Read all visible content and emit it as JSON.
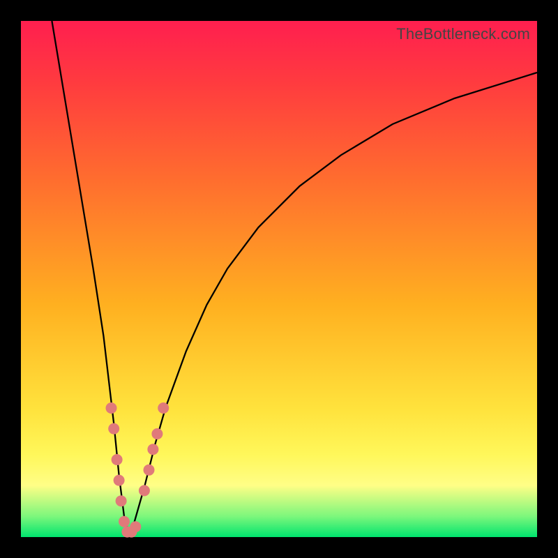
{
  "watermark": "TheBottleneck.com",
  "colors": {
    "frame": "#000000",
    "gradient_top": "#ff1f4f",
    "gradient_mid": "#ffe23c",
    "gradient_bottom": "#00e46e",
    "curve": "#000000",
    "dots": "#e07a7a"
  },
  "chart_data": {
    "type": "line",
    "title": "",
    "xlabel": "",
    "ylabel": "",
    "xlim": [
      0,
      100
    ],
    "ylim": [
      0,
      100
    ],
    "note": "V-shaped bottleneck curve; y is approximate bottleneck percentage, minimum near x≈21",
    "series": [
      {
        "name": "bottleneck-curve",
        "x": [
          6,
          8,
          10,
          12,
          14,
          16,
          18,
          19,
          20,
          21,
          22,
          24,
          26,
          28,
          32,
          36,
          40,
          46,
          54,
          62,
          72,
          84,
          100
        ],
        "values": [
          100,
          88,
          76,
          64,
          52,
          39,
          22,
          12,
          4,
          0,
          3,
          10,
          18,
          25,
          36,
          45,
          52,
          60,
          68,
          74,
          80,
          85,
          90
        ]
      }
    ],
    "points": [
      {
        "name": "left-cluster",
        "coords": [
          {
            "x": 17.5,
            "y": 25
          },
          {
            "x": 18.0,
            "y": 21
          },
          {
            "x": 18.6,
            "y": 15
          },
          {
            "x": 19.0,
            "y": 11
          },
          {
            "x": 19.4,
            "y": 7
          },
          {
            "x": 20.0,
            "y": 3
          },
          {
            "x": 20.6,
            "y": 1
          },
          {
            "x": 21.4,
            "y": 1
          },
          {
            "x": 22.2,
            "y": 2
          }
        ]
      },
      {
        "name": "right-cluster",
        "coords": [
          {
            "x": 23.9,
            "y": 9
          },
          {
            "x": 24.8,
            "y": 13
          },
          {
            "x": 25.6,
            "y": 17
          },
          {
            "x": 26.4,
            "y": 20
          },
          {
            "x": 27.6,
            "y": 25
          }
        ]
      }
    ]
  }
}
